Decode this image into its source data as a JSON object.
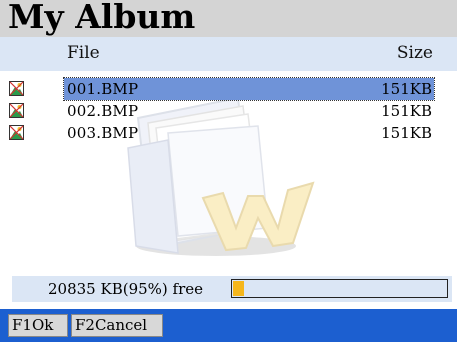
{
  "title": "My Album",
  "columns": {
    "file": "File",
    "size": "Size"
  },
  "files": [
    {
      "name": "001.BMP",
      "size": "151KB",
      "selected": true,
      "icon": "bmp-image-icon"
    },
    {
      "name": "002.BMP",
      "size": "151KB",
      "selected": false,
      "icon": "bmp-image-icon"
    },
    {
      "name": "003.BMP",
      "size": "151KB",
      "selected": false,
      "icon": "bmp-image-icon"
    }
  ],
  "storage": {
    "free_text": "20835 KB(95%) free",
    "used_fraction": 0.05
  },
  "softkeys": {
    "ok": "F1Ok",
    "cancel": "F2Cancel"
  },
  "colors": {
    "title_bg": "#d4d4d4",
    "header_bg": "#dbe6f5",
    "selection": "#6f93d8",
    "softkey_bar": "#1c5fd0",
    "meter_fill": "#f5b61b"
  },
  "watermark": "folder-icon"
}
